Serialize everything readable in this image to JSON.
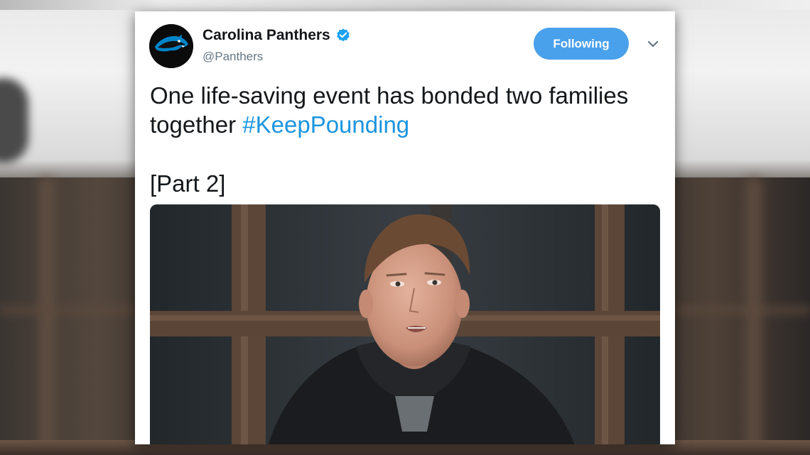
{
  "tweet": {
    "author_name": "Carolina Panthers",
    "handle": "@Panthers",
    "verified": true,
    "follow_label": "Following",
    "text_main": "One life-saving event has bonded two families together ",
    "hashtag": "#KeepPounding",
    "text_part": "[Part 2]",
    "media_type": "video"
  },
  "icons": {
    "avatar": "panther-logo-icon",
    "verified": "verified-badge-icon",
    "menu": "chevron-down-icon"
  },
  "colors": {
    "follow_button": "#4aa1eb",
    "hashtag": "#1b95e0",
    "verified_badge": "#1da1f2",
    "panther_logo": "#0085ca"
  }
}
